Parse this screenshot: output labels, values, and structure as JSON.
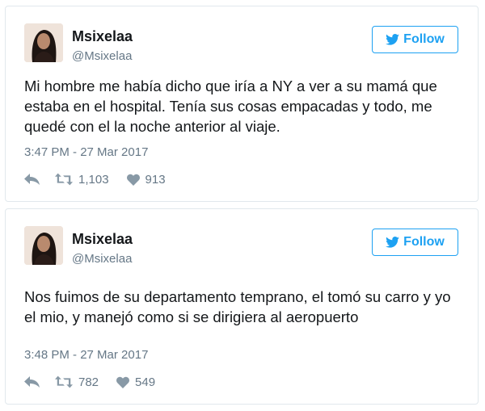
{
  "tweets": [
    {
      "display_name": "Msixelaa",
      "handle": "@Msixelaa",
      "follow_label": "Follow",
      "text": "Mi hombre me había dicho que iría a NY a ver a su mamá que estaba en el hospital. Tenía sus cosas empacadas y todo, me quedé con el la noche anterior al viaje.",
      "timestamp": "3:47 PM - 27 Mar 2017",
      "retweets": "1,103",
      "likes": "913"
    },
    {
      "display_name": "Msixelaa",
      "handle": "@Msixelaa",
      "follow_label": "Follow",
      "text": "Nos fuimos de su departamento temprano, el tomó su carro y yo el mio, y manejó como si se dirigiera al aeropuerto",
      "timestamp": "3:48 PM - 27 Mar 2017",
      "retweets": "782",
      "likes": "549"
    }
  ],
  "icons": {
    "follow": "twitter-bird-icon",
    "reply": "reply-icon",
    "retweet": "retweet-icon",
    "like": "heart-icon"
  },
  "colors": {
    "accent": "#1da1f2",
    "text": "#14171a",
    "muted": "#657786",
    "icon": "#8899a6",
    "border": "#e1e8ed"
  }
}
